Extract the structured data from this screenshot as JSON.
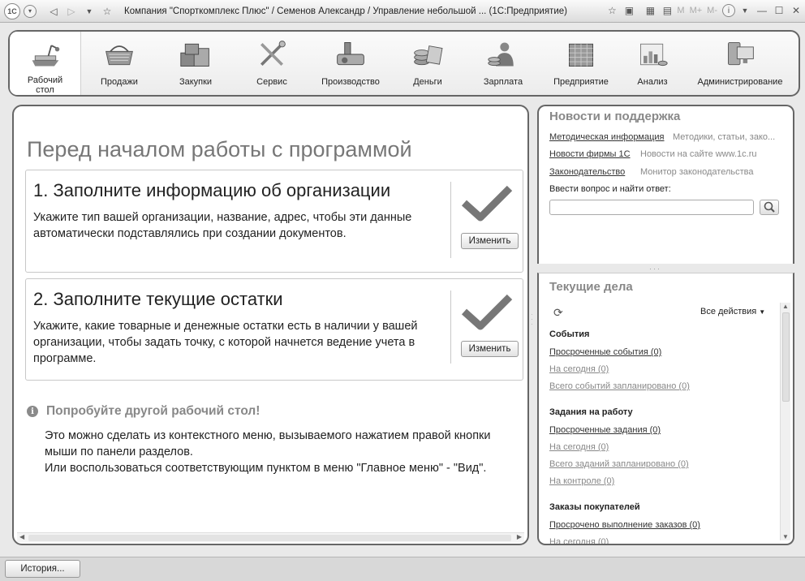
{
  "window": {
    "title": "Компания \"Спорткомплекс Плюс\" / Семенов Александр / Управление небольшой ... (1С:Предприятие)",
    "logo_text": "1С",
    "m_buttons": [
      "M",
      "M+",
      "M-"
    ]
  },
  "sections": [
    {
      "label": "Рабочий стол",
      "icon": "desktop-icon",
      "active": true
    },
    {
      "label": "Продажи",
      "icon": "basket-icon"
    },
    {
      "label": "Закупки",
      "icon": "boxes-icon"
    },
    {
      "label": "Сервис",
      "icon": "tools-icon"
    },
    {
      "label": "Производство",
      "icon": "factory-icon"
    },
    {
      "label": "Деньги",
      "icon": "coins-icon"
    },
    {
      "label": "Зарплата",
      "icon": "person-coins-icon"
    },
    {
      "label": "Предприятие",
      "icon": "building-icon"
    },
    {
      "label": "Анализ",
      "icon": "chart-icon"
    },
    {
      "label": "Администрирование",
      "icon": "computer-icon"
    }
  ],
  "main": {
    "heading": "Перед началом работы с программой",
    "step1": {
      "title": "1. Заполните информацию об организации",
      "text": "Укажите тип вашей организации, название, адрес, чтобы эти данные автоматически подставлялись при создании документов.",
      "button": "Изменить"
    },
    "step2": {
      "title": "2. Заполните текущие остатки",
      "text": "Укажите, какие товарные и денежные остатки есть в наличии у вашей организации, чтобы задать точку, с которой начнется ведение учета в программе.",
      "button": "Изменить"
    },
    "tip": {
      "title": "Попробуйте другой рабочий стол!",
      "line1": "Это можно сделать из контекстного меню, вызываемого нажатием правой кнопки мыши по панели разделов.",
      "line2": "Или воспользоваться соответствующим пунктом в меню \"Главное меню\" - \"Вид\"."
    }
  },
  "news": {
    "title": "Новости и поддержка",
    "rows": [
      {
        "link": "Методическая информация",
        "desc": "Методики, статьи, зако..."
      },
      {
        "link": "Новости фирмы 1С",
        "desc": "Новости на сайте www.1c.ru"
      },
      {
        "link": "Законодательство",
        "desc": "Монитор законодательства"
      }
    ],
    "ask_label": "Ввести вопрос и найти ответ:",
    "ask_value": ""
  },
  "tasks": {
    "title": "Текущие дела",
    "all_actions": "Все действия",
    "groups": [
      {
        "name": "События",
        "items": [
          {
            "label": "Просроченные события (0)",
            "style": "dark"
          },
          {
            "label": "На сегодня (0)",
            "style": "gray"
          },
          {
            "label": "Всего событий запланировано (0)",
            "style": "gray"
          }
        ]
      },
      {
        "name": "Задания на работу",
        "items": [
          {
            "label": "Просроченные задания (0)",
            "style": "dark"
          },
          {
            "label": "На сегодня (0)",
            "style": "gray"
          },
          {
            "label": "Всего заданий запланировано (0)",
            "style": "gray"
          },
          {
            "label": "На контроле (0)",
            "style": "gray"
          }
        ]
      },
      {
        "name": "Заказы покупателей",
        "items": [
          {
            "label": "Просрочено выполнение заказов (0)",
            "style": "dark"
          },
          {
            "label": "На сегодня (0)",
            "style": "gray"
          }
        ]
      }
    ]
  },
  "status": {
    "history_button": "История..."
  }
}
